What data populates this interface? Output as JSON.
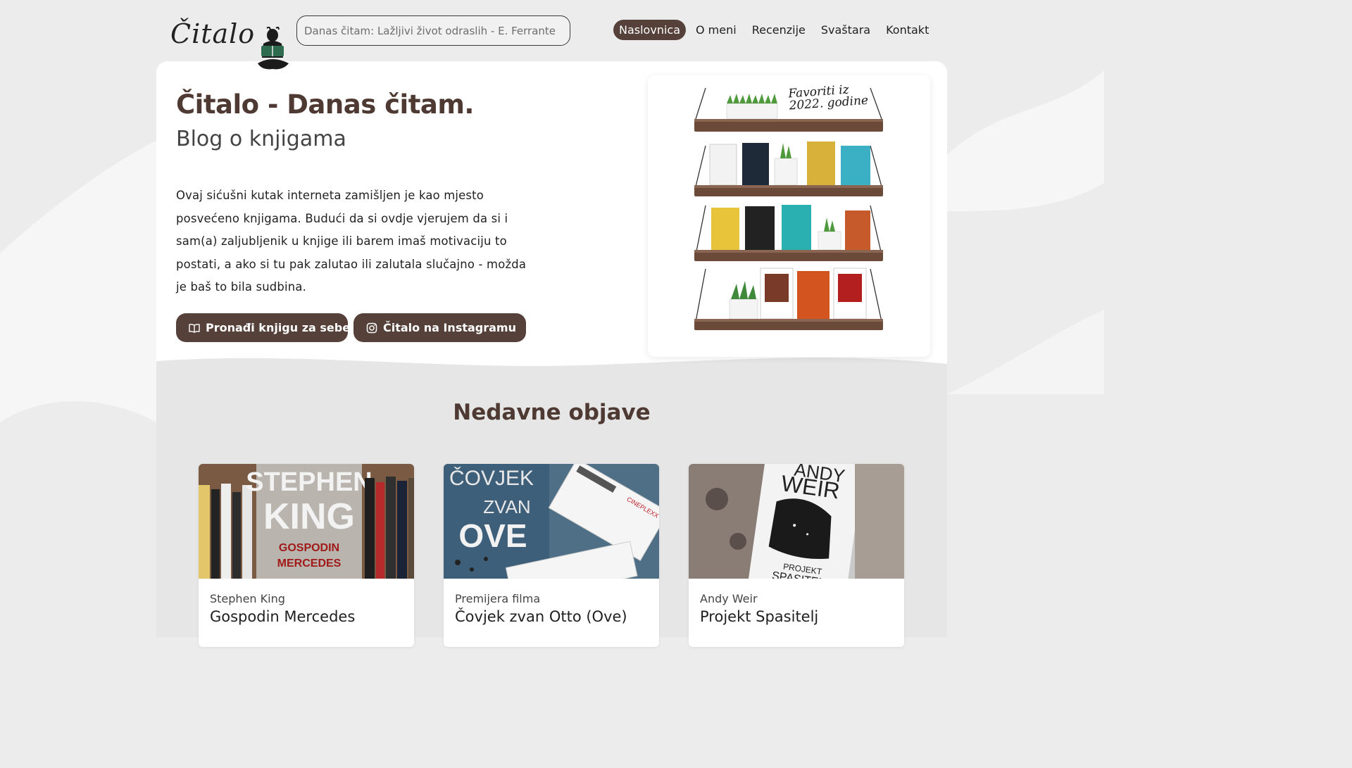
{
  "header": {
    "logo_text": "Čitalo",
    "search": {
      "value": "Danas čitam: Lažljivi život odraslih - E. Ferrante"
    },
    "nav": [
      {
        "label": "Naslovnica",
        "active": true
      },
      {
        "label": "O meni",
        "active": false
      },
      {
        "label": "Recenzije",
        "active": false
      },
      {
        "label": "Svaštara",
        "active": false
      },
      {
        "label": "Kontakt",
        "active": false
      }
    ]
  },
  "hero": {
    "title": "Čitalo - Danas čitam.",
    "subtitle": "Blog o knjigama",
    "text": "Ovaj sićušni kutak interneta zamišljen je kao mjesto posvećeno knjigama. Budući da si ovdje vjerujem da si i sam(a) zaljubljenik u knjige ili barem imaš motivaciju to postati, a ako si tu pak zalutao ili zalutala slučajno - možda je baš to bila sudbina.",
    "buttons": {
      "find_book": "Pronađi knjigu za sebe",
      "instagram": "Čitalo na Instagramu"
    },
    "shelf_caption": "Favoriti iz 2022. godine"
  },
  "recent": {
    "title": "Nedavne objave",
    "posts": [
      {
        "category": "Stephen King",
        "title": "Gospodin Mercedes",
        "cover_line1": "STEPHEN",
        "cover_line2": "KING",
        "cover_line3": "GOSPODIN",
        "cover_line4": "MERCEDES"
      },
      {
        "category": "Premijera filma",
        "title": "Čovjek zvan Otto (Ove)",
        "cover_line1": "ČOVJEK",
        "cover_line2": "ZVAN",
        "cover_line3": "OVE",
        "ticket_text": "CINEPLEXX"
      },
      {
        "category": "Andy Weir",
        "title": "Projekt Spasitelj",
        "cover_line1": "ANDY",
        "cover_line2": "WEIR",
        "cover_line3": "PROJEKT",
        "cover_line4": "SPASITELJ"
      }
    ]
  },
  "colors": {
    "accent": "#55413a",
    "heading": "#4e3a33",
    "background": "#ececec"
  }
}
